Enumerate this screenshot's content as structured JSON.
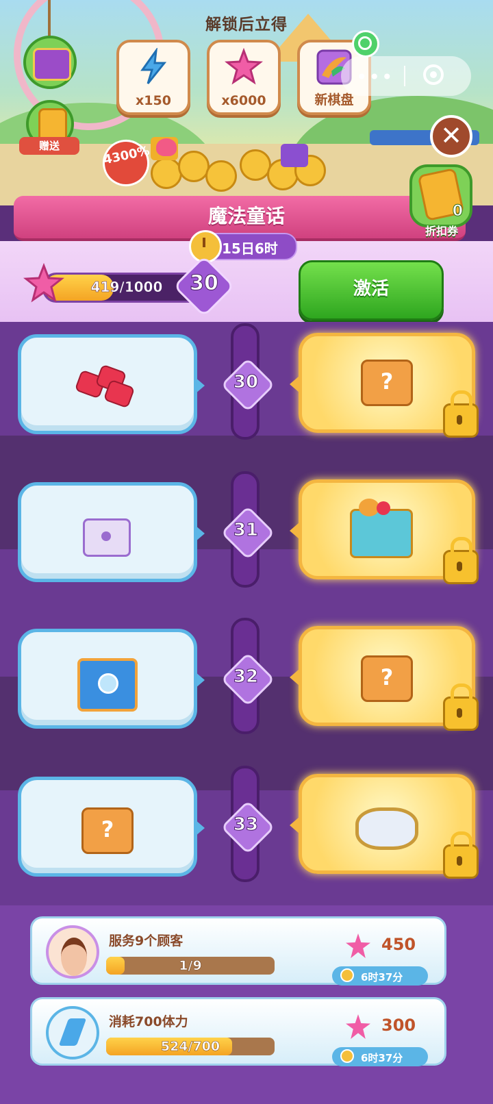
{
  "header": {
    "unlock_title": "解锁后立得",
    "rewards": [
      {
        "label": "x150",
        "icon": "energy-bolt-icon"
      },
      {
        "label": "x6000",
        "icon": "pink-star-icon"
      },
      {
        "label": "新棋盘",
        "icon": "new-board-icon"
      }
    ],
    "send_label": "赠送",
    "bonus_percent": "4300%",
    "coupon_count": "0",
    "coupon_label": "折扣券"
  },
  "banner": {
    "title": "魔法童话",
    "timer": "15日6时"
  },
  "progress": {
    "text": "419/1000",
    "fraction": 0.419,
    "level": "30",
    "activate_label": "激活"
  },
  "rows": [
    {
      "level": "30",
      "free_item": "ruby-gems-icon",
      "vip_item": "mystery-box-icon",
      "locked": true
    },
    {
      "level": "31",
      "free_item": "purple-chest-icon",
      "vip_item": "treasure-chest-icon",
      "locked": true
    },
    {
      "level": "32",
      "free_item": "blue-chest-icon",
      "vip_item": "mystery-box-icon",
      "locked": true
    },
    {
      "level": "33",
      "free_item": "mystery-box-icon",
      "vip_item": "shell-plate-icon",
      "locked": true
    }
  ],
  "tasks": [
    {
      "name": "服务9个顾客",
      "progress_text": "1/9",
      "fraction": 0.111,
      "reward": "450",
      "time": "6时37分",
      "icon": "customer-avatar-icon"
    },
    {
      "name": "消耗700体力",
      "progress_text": "524/700",
      "fraction": 0.749,
      "reward": "300",
      "time": "6时37分",
      "icon": "energy-bolt-icon"
    }
  ],
  "colors": {
    "activate_green": "#2ea61f",
    "banner_pink": "#d0417f",
    "track_purple": "#6a2f93",
    "vip_gold": "#f4b640",
    "free_blue": "#5bb5e6"
  }
}
